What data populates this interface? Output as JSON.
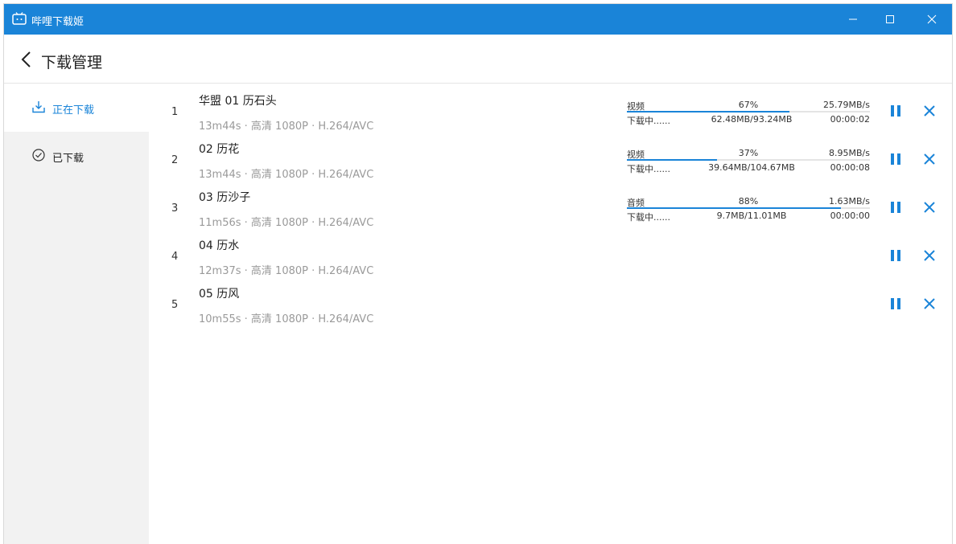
{
  "window": {
    "title": "哔哩下载姬",
    "accent_color": "#1a84d8",
    "controls": {
      "minimize_icon": "minimize-icon",
      "maximize_icon": "maximize-icon",
      "close_icon": "close-icon"
    }
  },
  "header": {
    "title": "下载管理",
    "back_icon": "back-arrow-icon"
  },
  "sidebar": {
    "items": [
      {
        "label": "正在下载",
        "icon": "download-icon",
        "active": true
      },
      {
        "label": "已下载",
        "icon": "check-circle-icon",
        "active": false
      }
    ]
  },
  "downloads": [
    {
      "index": "1",
      "title": "华盟 01  历石头",
      "meta": "13m44s · 高清 1080P · H.264/AVC",
      "progress": {
        "type": "视频",
        "percent": "67%",
        "fraction": 0.67,
        "speed": "25.79MB/s",
        "status": "下载中......",
        "size": "62.48MB/93.24MB",
        "eta": "00:00:02"
      }
    },
    {
      "index": "2",
      "title": "02  历花",
      "meta": "13m44s · 高清 1080P · H.264/AVC",
      "progress": {
        "type": "视频",
        "percent": "37%",
        "fraction": 0.37,
        "speed": "8.95MB/s",
        "status": "下载中......",
        "size": "39.64MB/104.67MB",
        "eta": "00:00:08"
      }
    },
    {
      "index": "3",
      "title": "03  历沙子",
      "meta": "11m56s · 高清 1080P · H.264/AVC",
      "progress": {
        "type": "音频",
        "percent": "88%",
        "fraction": 0.88,
        "speed": "1.63MB/s",
        "status": "下载中......",
        "size": "9.7MB/11.01MB",
        "eta": "00:00:00"
      }
    },
    {
      "index": "4",
      "title": "04  历水",
      "meta": "12m37s · 高清 1080P · H.264/AVC",
      "progress": null
    },
    {
      "index": "5",
      "title": "05  历风",
      "meta": "10m55s · 高清 1080P · H.264/AVC",
      "progress": null
    }
  ],
  "row_actions": {
    "pause_icon": "pause-icon",
    "cancel_icon": "close-icon"
  }
}
